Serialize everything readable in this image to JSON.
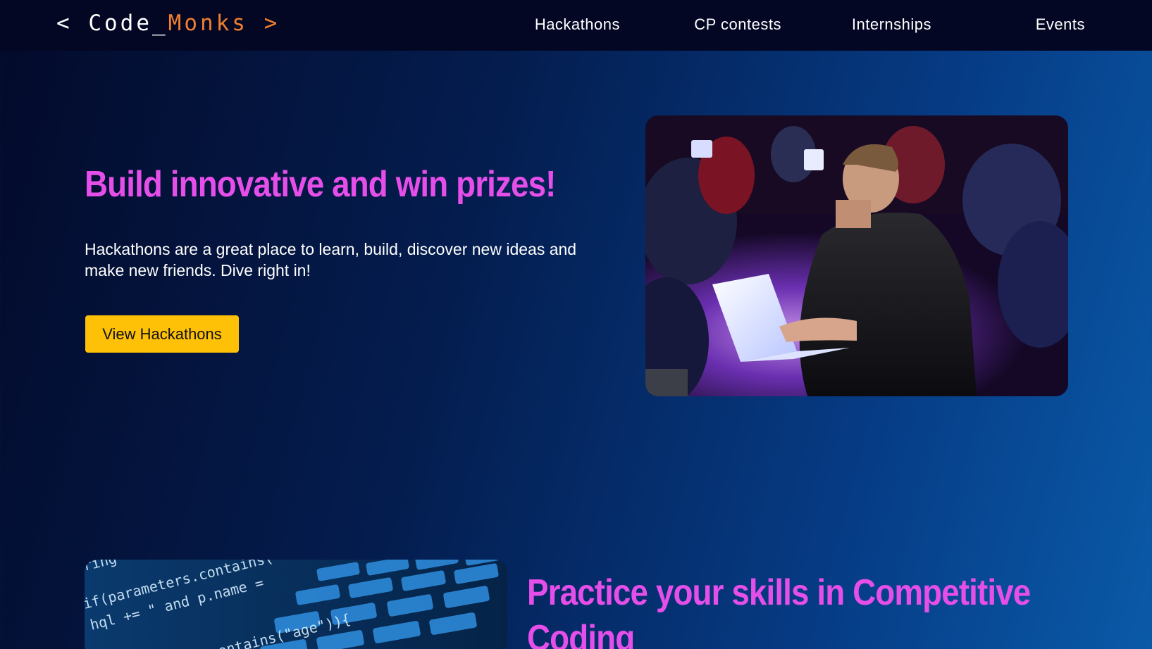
{
  "brand": {
    "prefix": "< Code_",
    "accent": "Monks",
    "suffix": " >",
    "accent_color": "#f07f2e"
  },
  "nav": {
    "items": [
      {
        "label": "Hackathons"
      },
      {
        "label": "CP contests"
      },
      {
        "label": "Internships"
      },
      {
        "label": "Events"
      }
    ]
  },
  "hackathon_section": {
    "title": "Build innovative and win prizes!",
    "description": "Hackathons are a great place to learn, build, discover new ideas and make new friends. Dive right in!",
    "button_label": "View Hackathons",
    "image_icon": "hackathon-photo"
  },
  "cp_section": {
    "title_line1": "Practice your skills in Competitive",
    "title_line2": "Coding",
    "image_icon": "code-keyboard-photo"
  },
  "colors": {
    "headline": "#e54ee8",
    "button": "#fec107",
    "navbar": "#030724"
  }
}
